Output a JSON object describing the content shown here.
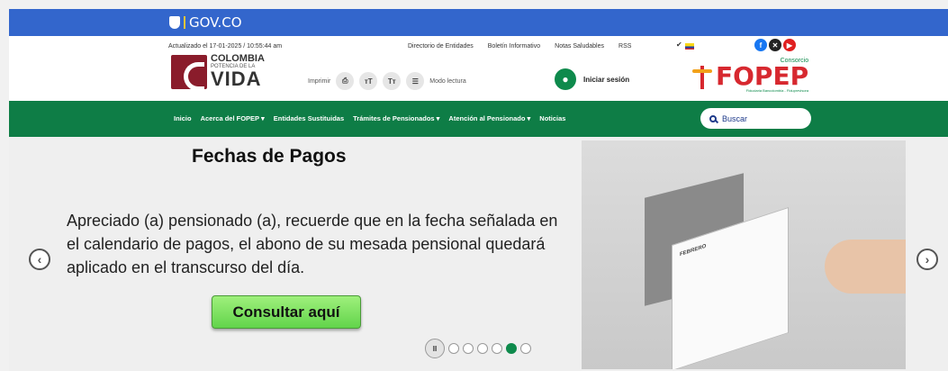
{
  "govbar": {
    "label": "GOV.CO"
  },
  "header": {
    "updated": "Actualizado el 17-01-2025 / 10:55:44 am",
    "links": [
      "Directorio de Entidades",
      "Boletín Informativo",
      "Notas Saludables",
      "RSS"
    ],
    "colombia_logo": {
      "line1": "COLOMBIA",
      "line2": "POTENCIA DE LA",
      "line3": "VIDA"
    },
    "tools": {
      "print_label": "Imprimir",
      "reading_label": "Modo lectura"
    },
    "login_label": "Iniciar sesión",
    "fopep_logo": {
      "top": "Consorcio",
      "main": "FOPEP",
      "sub": "Fiduciaria Bancolombia - Fiduprevisora"
    },
    "social_icons": [
      "facebook-icon",
      "x-icon",
      "youtube-icon"
    ]
  },
  "nav": {
    "items": [
      "Inicio",
      "Acerca del FOPEP ▾",
      "Entidades Sustituidas",
      "Trámites de Pensionados ▾",
      "Atención al Pensionado ▾",
      "Noticias"
    ],
    "search_placeholder": "Buscar"
  },
  "banner": {
    "title": "Fechas de Pagos",
    "text": "Apreciado (a) pensionado (a), recuerde que en la fecha señalada en el calendario de pagos, el abono de su mesada pensional quedará aplicado en el transcurso del día.",
    "button_label": "Consultar aquí",
    "calendar_month": "FEBRERO",
    "slides_total": 6,
    "active_slide": 5
  },
  "colors": {
    "gov_blue": "#3366cc",
    "nav_green": "#0e7d46",
    "fopep_red": "#d7282f"
  }
}
